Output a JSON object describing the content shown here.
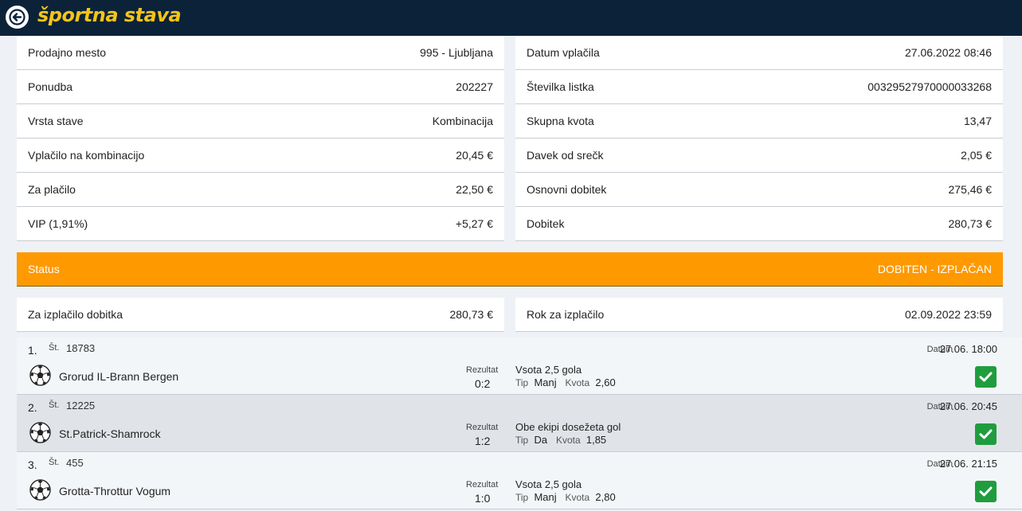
{
  "header": {
    "title": "športna stava",
    "back_icon": "back-arrow-icon",
    "colors": {
      "background": "#0b2239",
      "title": "#f6c417"
    }
  },
  "ticket_left": [
    {
      "label": "Prodajno mesto",
      "value": "995 - Ljubljana"
    },
    {
      "label": "Ponudba",
      "value": "202227"
    },
    {
      "label": "Vrsta stave",
      "value": "Kombinacija"
    },
    {
      "label": "Vplačilo na kombinacijo",
      "value": "20,45 €"
    },
    {
      "label": "Za plačilo",
      "value": "22,50 €"
    },
    {
      "label": "VIP (1,91%)",
      "value": "+5,27 €"
    }
  ],
  "ticket_right": [
    {
      "label": "Datum vplačila",
      "value": "27.06.2022 08:46"
    },
    {
      "label": "Številka listka",
      "value": "00329527970000033268"
    },
    {
      "label": "Skupna kvota",
      "value": "13,47"
    },
    {
      "label": "Davek od srečk",
      "value": "2,05 €"
    },
    {
      "label": "Osnovni dobitek",
      "value": "275,46 €"
    },
    {
      "label": "Dobitek",
      "value": "280,73 €"
    }
  ],
  "status": {
    "label": "Status",
    "value": "DOBITEN - IZPLAČAN",
    "color": "#ff9900"
  },
  "payout_left": {
    "label": "Za izplačilo dobitka",
    "value": "280,73 €"
  },
  "payout_right": {
    "label": "Rok za izplačilo",
    "value": "02.09.2022 23:59"
  },
  "bets": [
    {
      "num": "1.",
      "st_label": "Št.",
      "st_value": "18783",
      "date_label": "Datum",
      "date": "27.06. 18:00",
      "match": "Grorud IL-Brann Bergen",
      "result_label": "Rezultat",
      "result": "0:2",
      "market": "Vsota 2,5 gola",
      "tip_label": "Tip",
      "tip": "Manj",
      "odds_label": "Kvota",
      "odds": "2,60",
      "sport_icon": "soccer-ball-icon",
      "status_icon": "checkmark-icon"
    },
    {
      "num": "2.",
      "st_label": "Št.",
      "st_value": "12225",
      "date_label": "Datum",
      "date": "27.06. 20:45",
      "match": "St.Patrick-Shamrock",
      "result_label": "Rezultat",
      "result": "1:2",
      "market": "Obe ekipi dosežeta gol",
      "tip_label": "Tip",
      "tip": "Da",
      "odds_label": "Kvota",
      "odds": "1,85",
      "sport_icon": "soccer-ball-icon",
      "status_icon": "checkmark-icon"
    },
    {
      "num": "3.",
      "st_label": "Št.",
      "st_value": "455",
      "date_label": "Datum",
      "date": "27.06. 21:15",
      "match": "Grotta-Throttur Vogum",
      "result_label": "Rezultat",
      "result": "1:0",
      "market": "Vsota 2,5 gola",
      "tip_label": "Tip",
      "tip": "Manj",
      "odds_label": "Kvota",
      "odds": "2,80",
      "sport_icon": "soccer-ball-icon",
      "status_icon": "checkmark-icon"
    }
  ]
}
